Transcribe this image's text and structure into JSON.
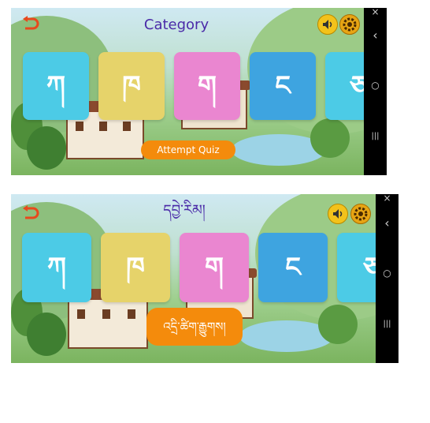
{
  "screen1": {
    "title": "Category",
    "cards": [
      {
        "letter": "ཀ",
        "color": "#4ccbe6"
      },
      {
        "letter": "ཁ",
        "color": "#e6d36a"
      },
      {
        "letter": "ག",
        "color": "#ea86d0"
      },
      {
        "letter": "ང",
        "color": "#3ea4e0"
      },
      {
        "letter": "ཅ",
        "color": "#4ccbe6"
      }
    ],
    "quiz_label": "Attempt Quiz"
  },
  "screen2": {
    "title": "དབྱེ་རིམ།",
    "cards": [
      {
        "letter": "ཀ",
        "color": "#4ccbe6"
      },
      {
        "letter": "ཁ",
        "color": "#e6d36a"
      },
      {
        "letter": "ག",
        "color": "#ea86d0"
      },
      {
        "letter": "ང",
        "color": "#3ea4e0"
      },
      {
        "letter": "ཅ",
        "color": "#4ccbe6"
      }
    ],
    "quiz_label": "འདྲི་ཚིག་རྒྱུགས།"
  },
  "icons": {
    "back": "back-arrow-icon",
    "sound": "speaker-icon",
    "settings": "gear-icon",
    "nav_back": "‹",
    "nav_home": "○",
    "nav_recent": "|||",
    "nav_close": "×"
  },
  "colors": {
    "title": "#4a2aa8",
    "quiz_button": "#f48b0c",
    "back_icon": "#e8491d"
  }
}
